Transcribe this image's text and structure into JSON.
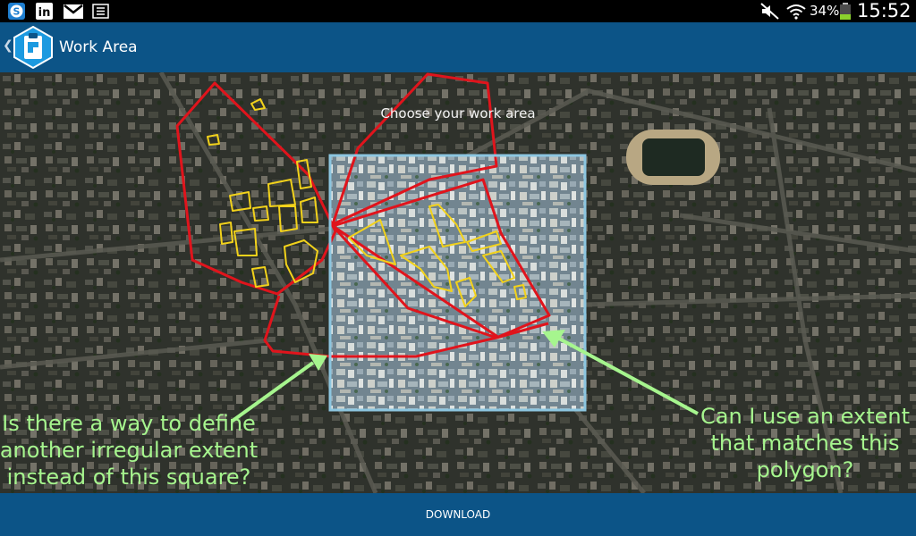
{
  "status_bar": {
    "battery_text": "34%",
    "clock": "15:52",
    "icons": [
      "skype-icon",
      "linkedin-icon",
      "gmail-icon",
      "screen-mirror-icon",
      "mute-icon",
      "wifi-icon",
      "battery-icon"
    ]
  },
  "app_bar": {
    "title": "Work Area",
    "back_icon": "chevron-left-icon",
    "logo_icon": "clipboard-app-icon"
  },
  "map": {
    "prompt": "Choose your work area"
  },
  "annotations": {
    "left": "Is there a way to define another irregular extent instead of this square?",
    "right": "Can I use an extent that matches this polygon?"
  },
  "bottom_bar": {
    "download_label": "DOWNLOAD"
  },
  "colors": {
    "app_bar": "#0c5487",
    "polygon_outline": "#e0141c",
    "building_outline": "#f2d21b",
    "selection_frame": "#8cc6e0",
    "annotation_text": "#a6f58e"
  }
}
